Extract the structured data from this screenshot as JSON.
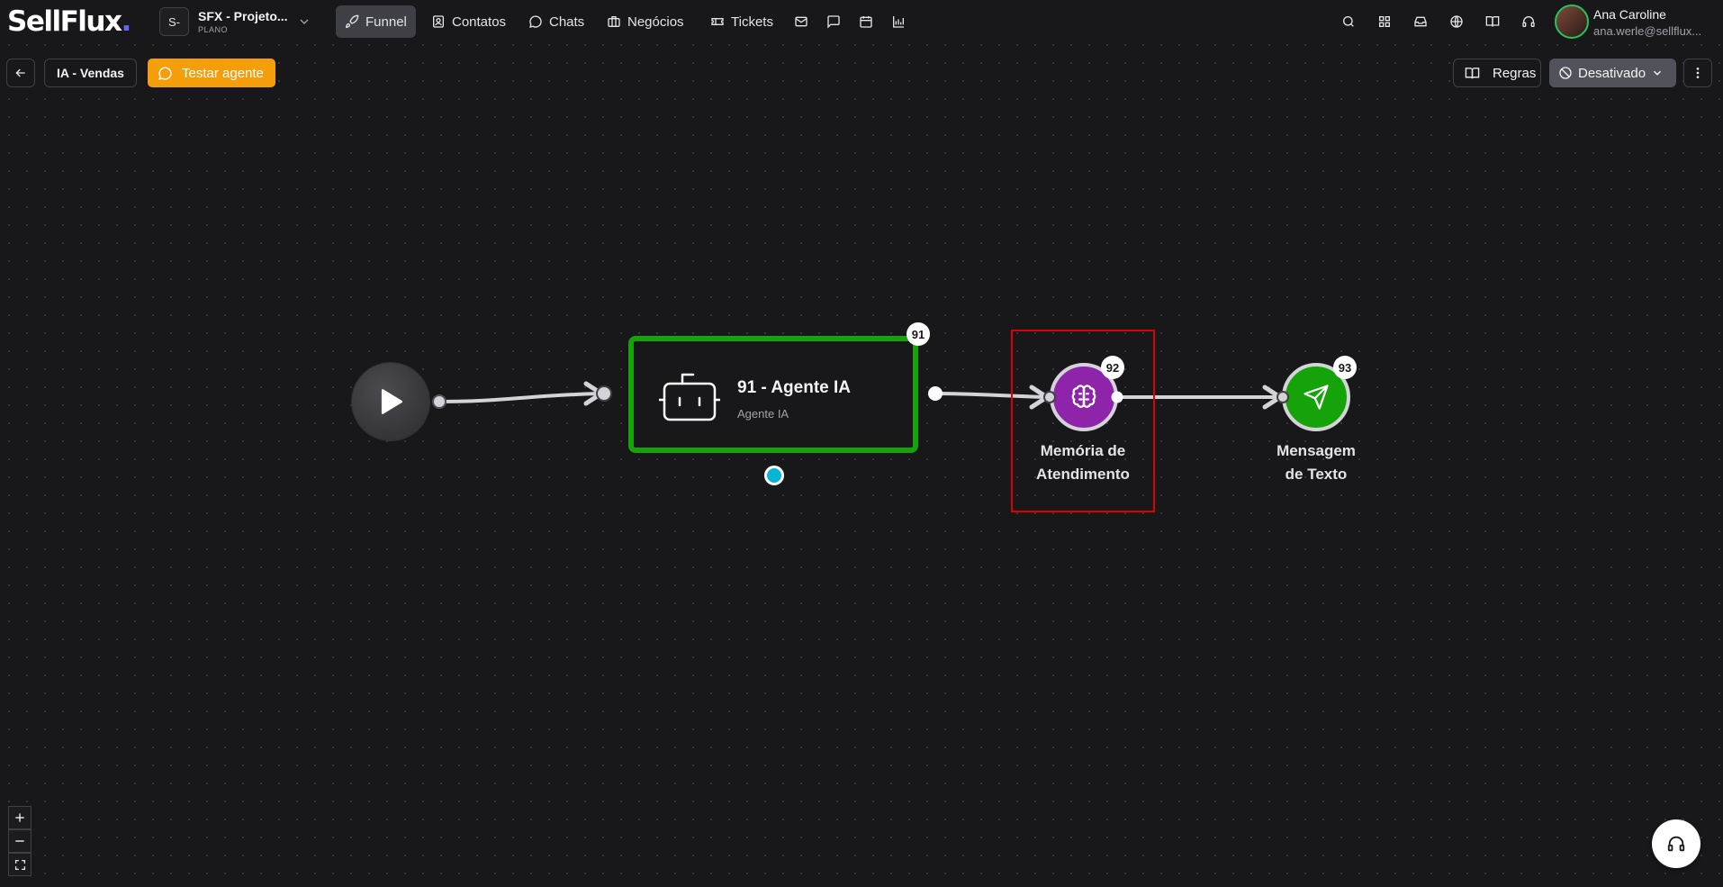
{
  "brand": {
    "logo_text": "SellFlux",
    "logo_dot": "."
  },
  "project": {
    "initials": "S-",
    "name": "SFX - Projeto...",
    "plan": "PLANO"
  },
  "nav": [
    {
      "label": "Funnel",
      "icon": "rocket-icon",
      "active": true
    },
    {
      "label": "Contatos",
      "icon": "contacts-icon",
      "active": false
    },
    {
      "label": "Chats",
      "icon": "chat-bubble-icon",
      "active": false
    },
    {
      "label": "Negócios",
      "icon": "briefcase-icon",
      "active": false
    },
    {
      "label": "Tickets",
      "icon": "ticket-icon",
      "active": false
    }
  ],
  "nav_icons": [
    "mail-icon",
    "message-square-icon",
    "calendar-icon",
    "bar-chart-icon"
  ],
  "header_icons": [
    "search-icon",
    "apps-grid-icon",
    "inbox-icon",
    "globe-icon",
    "book-open-icon",
    "headset-icon"
  ],
  "user": {
    "name": "Ana Caroline",
    "email": "ana.werle@sellflux..."
  },
  "toolbar": {
    "flow_name": "IA - Vendas",
    "test_label": "Testar agente",
    "rules_label": "Regras",
    "status_label": "Desativado"
  },
  "nodes": {
    "agent": {
      "badge": "91",
      "title": "91 - Agente IA",
      "subtitle": "Agente IA",
      "border_color": "#16a30a"
    },
    "memory": {
      "badge": "92",
      "label_line1": "Memória de",
      "label_line2": "Atendimento",
      "color": "#8e24aa"
    },
    "message": {
      "badge": "93",
      "label_line1": "Mensagem",
      "label_line2": "de Texto",
      "color": "#16a30a"
    }
  },
  "zoom_controls": [
    "zoom-in",
    "zoom-out",
    "fit-view"
  ],
  "colors": {
    "accent_orange": "#f59e0b",
    "highlight_red": "#e00000",
    "handle_cyan": "#06b6d4",
    "status_gray": "#52525b"
  }
}
